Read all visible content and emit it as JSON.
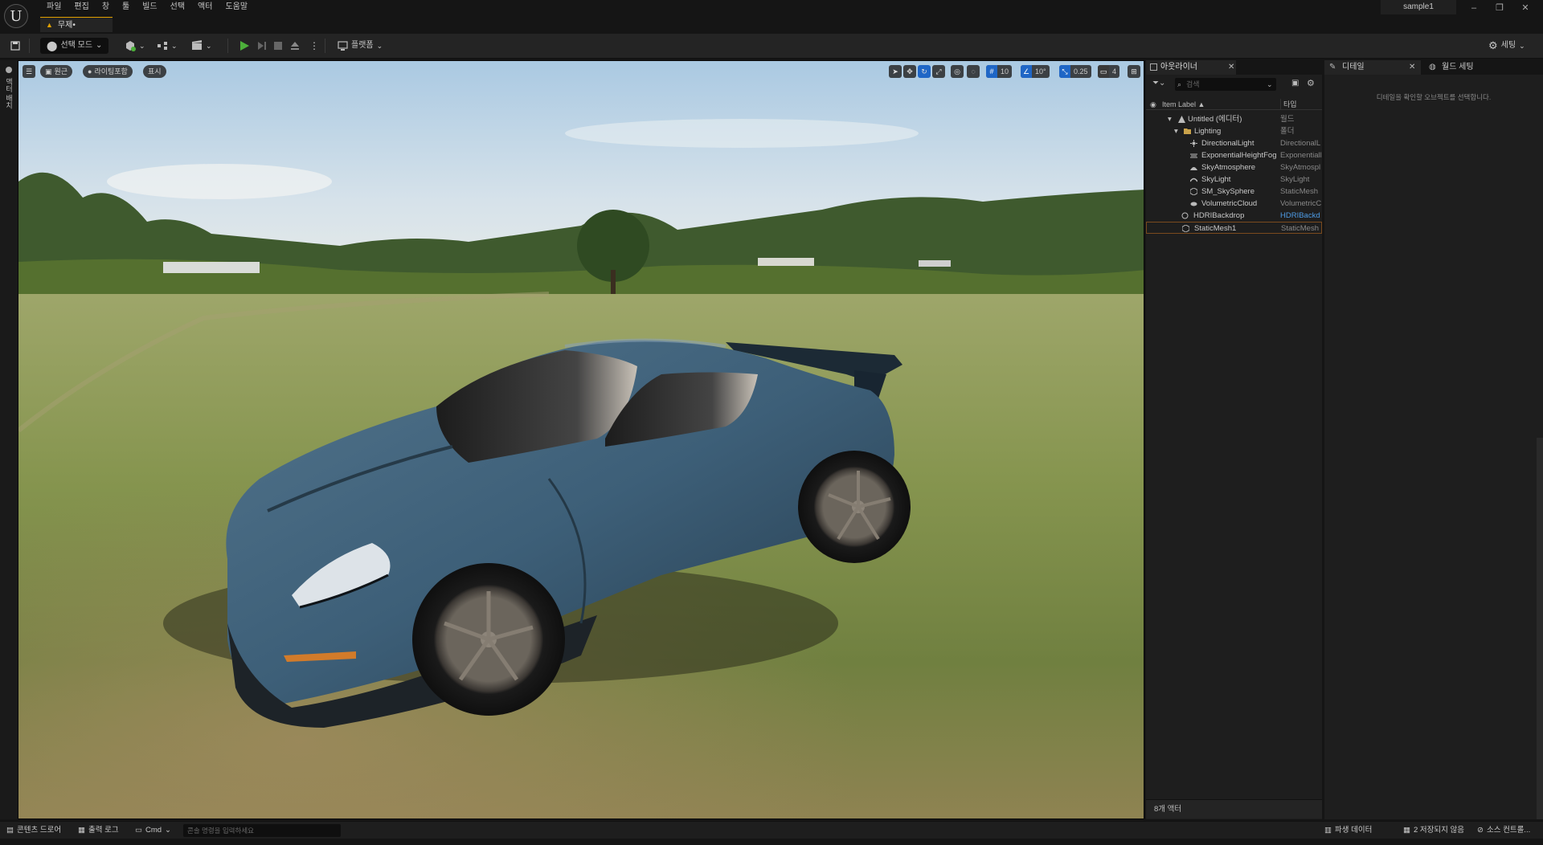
{
  "window": {
    "project_name": "sample1",
    "level_tab": "무제•",
    "menu": [
      "파일",
      "편집",
      "창",
      "툴",
      "빌드",
      "선택",
      "액터",
      "도움말"
    ]
  },
  "toolbar": {
    "mode_label": "선택 모드",
    "platforms_label": "플랫폼",
    "settings_label": "세팅"
  },
  "left_strip": {
    "label": "액터 배치"
  },
  "viewport": {
    "perspective_label": "원근",
    "lit_label": "라이팅포함",
    "show_label": "표시",
    "grid_snap": "10",
    "rotation_snap": "10°",
    "scale_snap": "0.25",
    "camera_speed": "4"
  },
  "outliner": {
    "tab_label": "아웃라이너",
    "search_placeholder": "검색",
    "col_label": "Item Label ▲",
    "col_type": "타입",
    "rows": [
      {
        "label": "Untitled (에디터)",
        "type": "월드"
      },
      {
        "label": "Lighting",
        "type": "폴더"
      },
      {
        "label": "DirectionalLight",
        "type": "DirectionalL"
      },
      {
        "label": "ExponentialHeightFog",
        "type": "Exponentiall"
      },
      {
        "label": "SkyAtmosphere",
        "type": "SkyAtmospl"
      },
      {
        "label": "SkyLight",
        "type": "SkyLight"
      },
      {
        "label": "SM_SkySphere",
        "type": "StaticMesh"
      },
      {
        "label": "VolumetricCloud",
        "type": "VolumetricC"
      },
      {
        "label": "HDRIBackdrop",
        "type": "HDRIBackd"
      },
      {
        "label": "StaticMesh1",
        "type": "StaticMesh"
      }
    ],
    "footer": "8개 액터"
  },
  "details": {
    "tab_details": "디테일",
    "tab_world": "월드 세팅",
    "empty_text": "디테일을 확인할 오브젝트를 선택합니다."
  },
  "statusbar": {
    "content_drawer": "콘텐츠 드로어",
    "output_log": "출력 로그",
    "cmd_label": "Cmd",
    "cmd_placeholder": "콘솔 명령을 입력하세요",
    "derived_data": "파생 데이터",
    "unsaved": "2 저장되지 않음",
    "source_control": "소스 컨트롤..."
  },
  "colors": {
    "accent_blue": "#1f66c6",
    "play_green": "#4caf3a",
    "level_tab_accent": "#e0a000",
    "car_body": "#3d5f78"
  }
}
